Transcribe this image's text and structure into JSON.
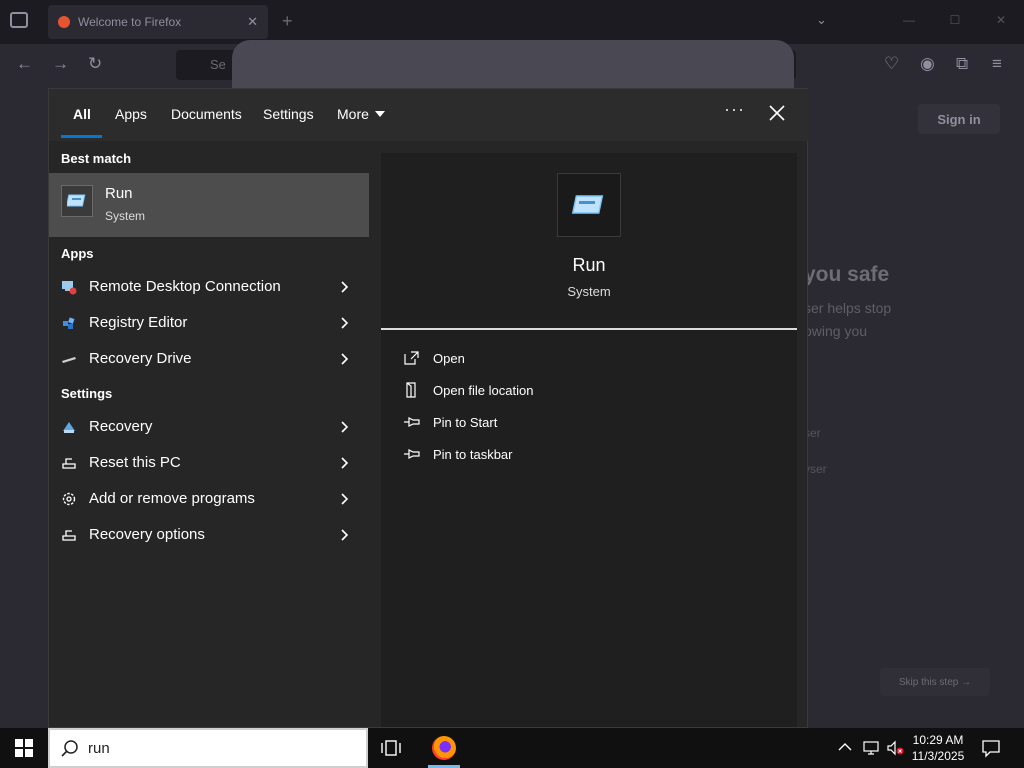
{
  "browser": {
    "tab_title": "Welcome to Firefox",
    "url_placeholder": "Se",
    "signin_label": "Sign in",
    "heading_fragment": "you safe",
    "sub_line1": "ser helps stop",
    "sub_line2": "owing you",
    "option1": "ser",
    "option2": "vser",
    "skip_label": "Skip this step →"
  },
  "search": {
    "tabs": [
      {
        "label": "All"
      },
      {
        "label": "Apps"
      },
      {
        "label": "Documents"
      },
      {
        "label": "Settings"
      },
      {
        "label": "More"
      }
    ],
    "best_match_label": "Best match",
    "best_match": {
      "title": "Run",
      "subtitle": "System",
      "icon": "run-icon"
    },
    "apps_label": "Apps",
    "apps": [
      {
        "label": "Remote Desktop Connection",
        "icon": "remote-desktop-icon"
      },
      {
        "label": "Registry Editor",
        "icon": "registry-editor-icon"
      },
      {
        "label": "Recovery Drive",
        "icon": "recovery-drive-icon"
      }
    ],
    "settings_label": "Settings",
    "settings": [
      {
        "label": "Recovery",
        "icon": "recovery-icon"
      },
      {
        "label": "Reset this PC",
        "icon": "reset-pc-icon"
      },
      {
        "label": "Add or remove programs",
        "icon": "gear-icon"
      },
      {
        "label": "Recovery options",
        "icon": "recovery-options-icon"
      }
    ],
    "detail": {
      "title": "Run",
      "subtitle": "System",
      "actions": [
        {
          "label": "Open",
          "icon": "open-icon"
        },
        {
          "label": "Open file location",
          "icon": "file-location-icon"
        },
        {
          "label": "Pin to Start",
          "icon": "pin-icon"
        },
        {
          "label": "Pin to taskbar",
          "icon": "pin-icon"
        }
      ]
    }
  },
  "taskbar": {
    "search_value": "run",
    "time": "10:29 AM",
    "date": "11/3/2025"
  },
  "colors": {
    "accent": "#0078d4",
    "panel_bg": "#262626",
    "selected_row": "#4d4d4d"
  }
}
